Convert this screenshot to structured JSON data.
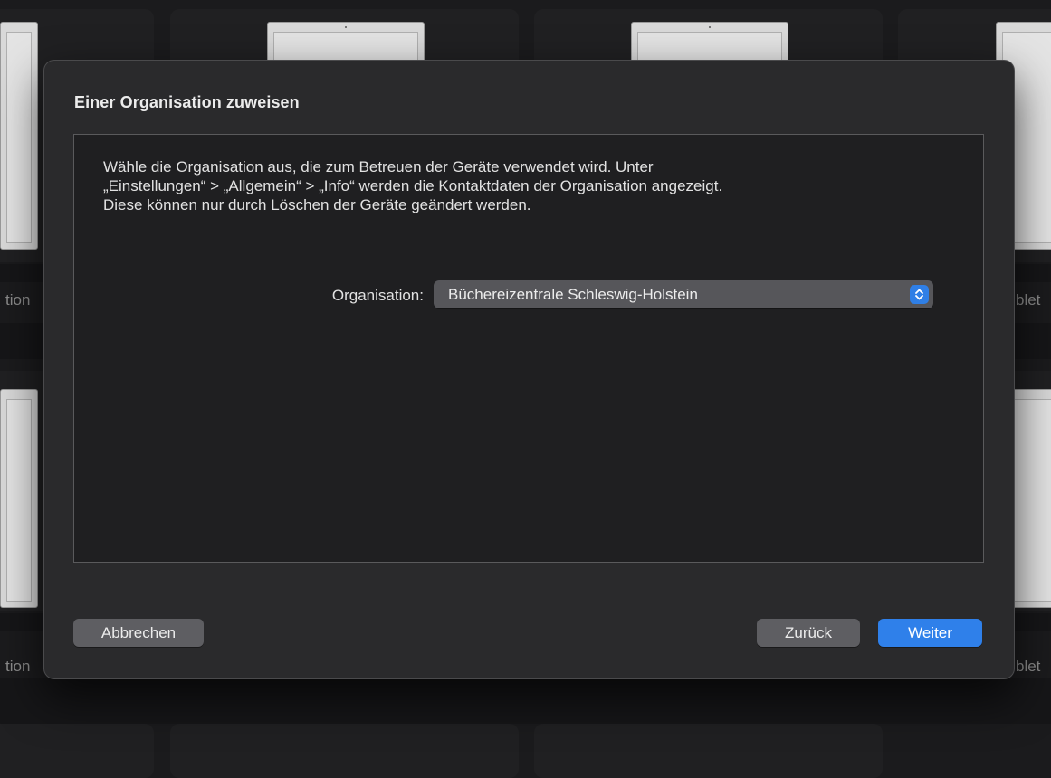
{
  "background": {
    "left_label": "tion",
    "right_label": "blet"
  },
  "dialog": {
    "title": "Einer Organisation zuweisen",
    "description_lines": [
      "Wähle die Organisation aus, die zum Betreuen der Geräte verwendet wird. Unter",
      "„Einstellungen“ > „Allgemein“ > „Info“ werden die Kontaktdaten der Organisation angezeigt.",
      "Diese können nur durch Löschen der Geräte geändert werden."
    ],
    "organisation": {
      "label": "Organisation:",
      "selected": "Büchereizentrale Schleswig-Holstein"
    },
    "buttons": {
      "cancel": "Abbrechen",
      "back": "Zurück",
      "next": "Weiter"
    }
  },
  "colors": {
    "accent": "#2f80ea",
    "dialog_bg": "#2a2a2c",
    "content_bg": "#1f1f21"
  },
  "icons": {
    "select_stepper": "chevron-up-down-icon"
  }
}
